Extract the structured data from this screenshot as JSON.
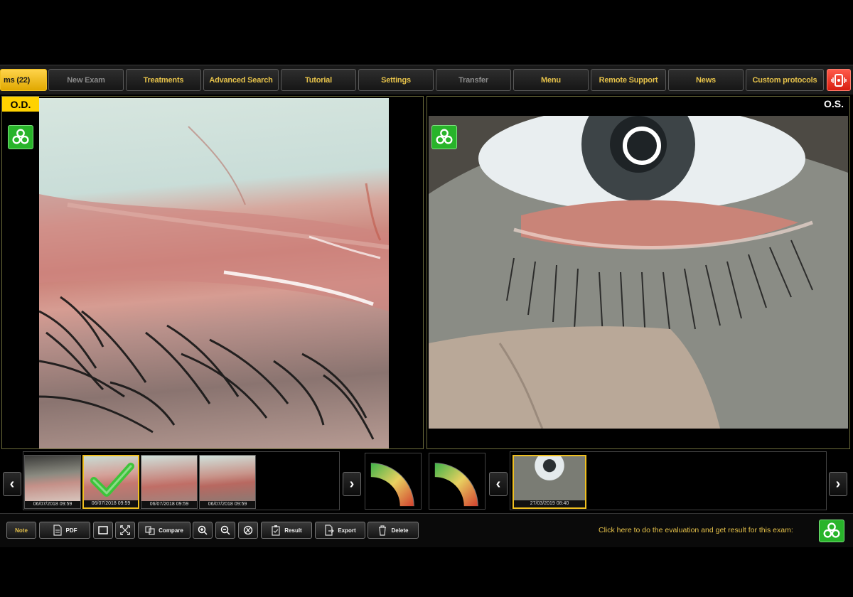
{
  "tabs": [
    {
      "label": "ms (22)",
      "state": "active"
    },
    {
      "label": "New Exam",
      "state": "disabled"
    },
    {
      "label": "Treatments",
      "state": "normal"
    },
    {
      "label": "Advanced Search",
      "state": "normal"
    },
    {
      "label": "Tutorial",
      "state": "normal"
    },
    {
      "label": "Settings",
      "state": "normal"
    },
    {
      "label": "Transfer",
      "state": "disabled"
    },
    {
      "label": "Menu",
      "state": "normal"
    },
    {
      "label": "Remote Support",
      "state": "normal"
    },
    {
      "label": "News",
      "state": "normal"
    },
    {
      "label": "Custom protocols",
      "state": "normal"
    }
  ],
  "panels": {
    "od_label": "O.D.",
    "os_label": "O.S."
  },
  "thumbnails_od": [
    {
      "date": "06/07/2018 09:59",
      "selected": false,
      "checked": false
    },
    {
      "date": "06/07/2018 09:59",
      "selected": true,
      "checked": true
    },
    {
      "date": "06/07/2018 09:59",
      "selected": false,
      "checked": false
    },
    {
      "date": "06/07/2018 09:59",
      "selected": false,
      "checked": false
    }
  ],
  "thumbnails_os": [
    {
      "date": "27/03/2019 08:40",
      "selected": true
    }
  ],
  "toolbar": {
    "note": "Note",
    "pdf": "PDF",
    "compare": "Compare",
    "result": "Result",
    "export": "Export",
    "delete": "Delete",
    "hint": "Click here to do the evaluation and get result for this exam:"
  },
  "colors": {
    "accent": "#e6c24a",
    "active_tab": "#ffd200",
    "eval_green": "#28b42a",
    "alert_red": "#e8281a"
  }
}
